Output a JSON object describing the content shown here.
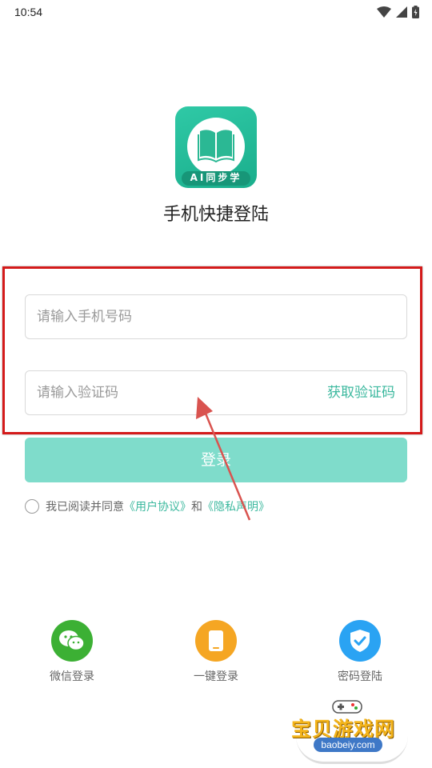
{
  "status_bar": {
    "time": "10:54"
  },
  "logo": {
    "caption": "AI同步学"
  },
  "page_title": "手机快捷登陆",
  "phone_field": {
    "placeholder": "请输入手机号码",
    "value": ""
  },
  "code_field": {
    "placeholder": "请输入验证码",
    "value": "",
    "get_code_label": "获取验证码"
  },
  "login_button": {
    "label": "登录"
  },
  "agreement": {
    "prefix": "我已阅读并同意",
    "user_agreement": "《用户协议》",
    "and": "和",
    "privacy": "《隐私声明》"
  },
  "login_options": [
    {
      "label": "微信登录",
      "icon": "wechat-icon",
      "color": "#3cb034"
    },
    {
      "label": "一键登录",
      "icon": "phone-icon",
      "color": "#f5a623"
    },
    {
      "label": "密码登陆",
      "icon": "shield-check-icon",
      "color": "#2aa3f3"
    }
  ],
  "watermark": {
    "title": "宝贝游戏网",
    "url": "baobeiy.com"
  },
  "colors": {
    "accent": "#3bb89e",
    "button": "#7fdccb",
    "highlight": "#d41a1a"
  }
}
